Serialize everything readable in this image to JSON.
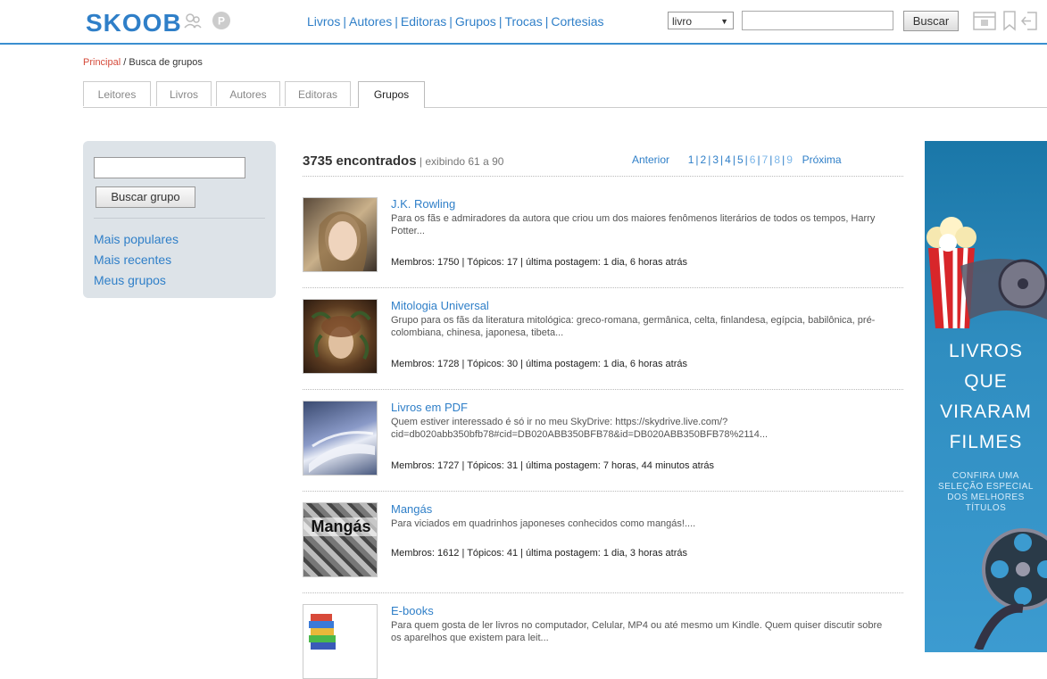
{
  "header": {
    "logo": "SKOOB",
    "nav": [
      "Livros",
      "Autores",
      "Editoras",
      "Grupos",
      "Trocas",
      "Cortesias"
    ],
    "select_value": "livro",
    "search_button": "Buscar"
  },
  "breadcrumb": {
    "home": "Principal",
    "sep": " / ",
    "current": "Busca de grupos"
  },
  "tabs": [
    "Leitores",
    "Livros",
    "Autores",
    "Editoras",
    "Grupos"
  ],
  "active_tab": "Grupos",
  "sidebar": {
    "button": "Buscar grupo",
    "links": [
      "Mais populares",
      "Mais recentes",
      "Meus grupos"
    ]
  },
  "results_header": {
    "count": "3735 encontrados",
    "showing": " | exibindo 61 a 90",
    "prev": "Anterior",
    "pages": [
      "1",
      "2",
      "3",
      "4",
      "5",
      "6",
      "7",
      "8",
      "9"
    ],
    "next": "Próxima"
  },
  "groups": [
    {
      "title": "J.K. Rowling",
      "description": "Para os fãs e admiradores da autora que criou um dos maiores fenômenos literários de todos os tempos, Harry Potter...",
      "meta": "Membros: 1750 | Tópicos: 17 | última postagem: 1 dia, 6 horas atrás"
    },
    {
      "title": "Mitologia Universal",
      "description": "Grupo para os fãs da literatura mitológica: greco-romana, germânica, celta, finlandesa, egípcia, babilônica, pré-colombiana, chinesa, japonesa, tibeta...",
      "meta": "Membros: 1728 | Tópicos: 30 | última postagem: 1 dia, 6 horas atrás"
    },
    {
      "title": "Livros em PDF",
      "description": "Quem estiver interessado é só ir no meu SkyDrive: https://skydrive.live.com/?cid=db020abb350bfb78#cid=DB020ABB350BFB78&id=DB020ABB350BFB78%2114...",
      "meta": "Membros: 1727 | Tópicos: 31 | última postagem: 7 horas, 44 minutos atrás"
    },
    {
      "title": "Mangás",
      "thumb_text": "Mangás",
      "description": "Para viciados em quadrinhos japoneses conhecidos como mangás!....",
      "meta": "Membros: 1612 | Tópicos: 41 | última postagem: 1 dia, 3 horas atrás"
    },
    {
      "title": "E-books",
      "description": "Para quem gosta de ler livros no computador, Celular, MP4 ou até mesmo um Kindle. Quem quiser discutir sobre os aparelhos que existem para leit...",
      "meta": ""
    }
  ],
  "ad": {
    "lines": [
      "LIVROS",
      "QUE",
      "VIRARAM",
      "FILMES"
    ],
    "sub": [
      "CONFIRA UMA",
      "SELEÇÃO ESPECIAL",
      "DOS MELHORES",
      "TÍTULOS"
    ]
  }
}
